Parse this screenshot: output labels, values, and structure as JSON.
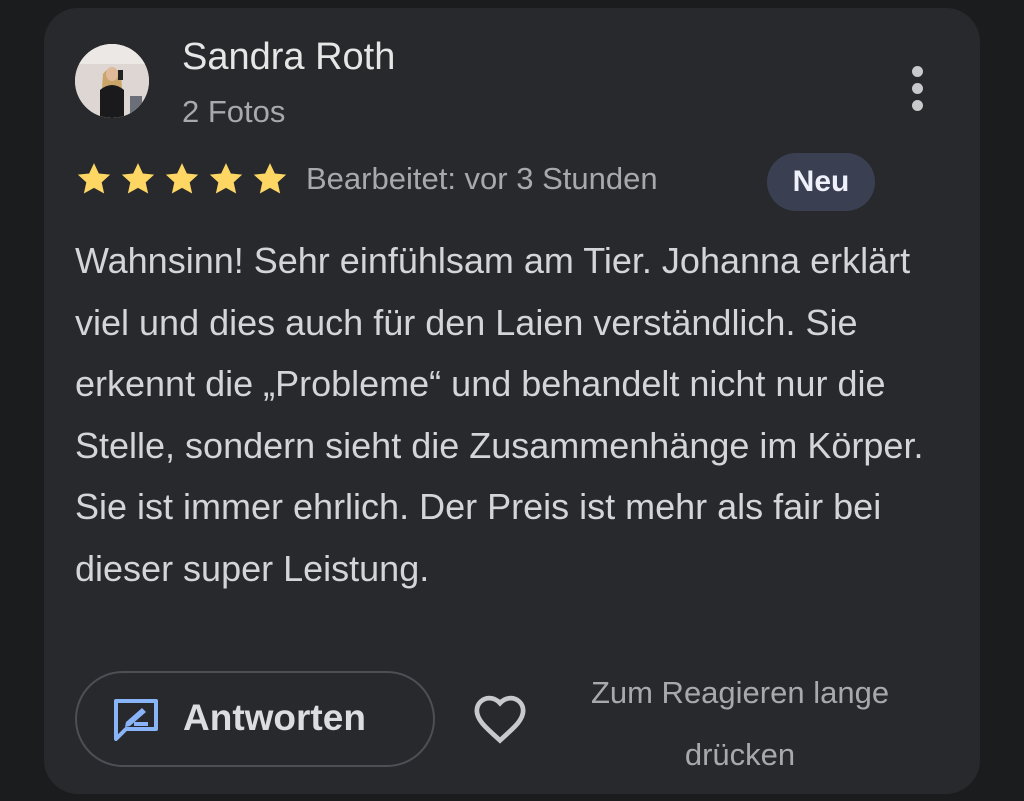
{
  "review": {
    "author_name": "Sandra Roth",
    "author_meta": "2 Fotos",
    "rating": 5,
    "rating_max": 5,
    "edited_text": "Bearbeitet: vor 3 Stunden",
    "badge": "Neu",
    "text": "Wahnsinn! Sehr einfühlsam am Tier. Johanna erklärt viel und dies auch für den Laien verständlich. Sie erkennt die „Probleme“ und behandelt nicht nur die Stelle, sondern sieht die Zusammenhänge im Körper. Sie ist immer ehrlich. Der Preis ist mehr als fair bei dieser super Leistung."
  },
  "actions": {
    "reply_label": "Antworten",
    "react_hint_line1": "Zum Reagieren lange",
    "react_hint_line2": "drücken"
  },
  "icons": {
    "more": "more-vert-icon",
    "star": "star-icon",
    "reply": "reply-edit-icon",
    "heart": "heart-outline-icon"
  },
  "colors": {
    "background": "#1b1c1e",
    "card": "#28292c",
    "star": "#fdd663",
    "badge_bg": "#3a3f52",
    "accent_blue": "#8ab4f8"
  }
}
